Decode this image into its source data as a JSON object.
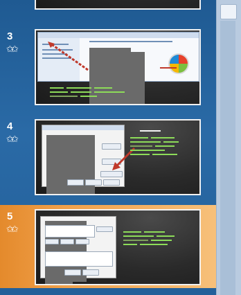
{
  "slides": [
    {
      "number": ""
    },
    {
      "number": "3",
      "star": "✩✩"
    },
    {
      "number": "4",
      "star": "✩✩"
    },
    {
      "number": "5",
      "star": "✩✩",
      "selected": true
    }
  ],
  "colors": {
    "panel_bg": "#1f5a92",
    "selected_bg": "#e48a2c",
    "thumb_bg": "#2b2b2b",
    "text_green": "#8ddc59",
    "arrow_red": "#c0392b"
  }
}
